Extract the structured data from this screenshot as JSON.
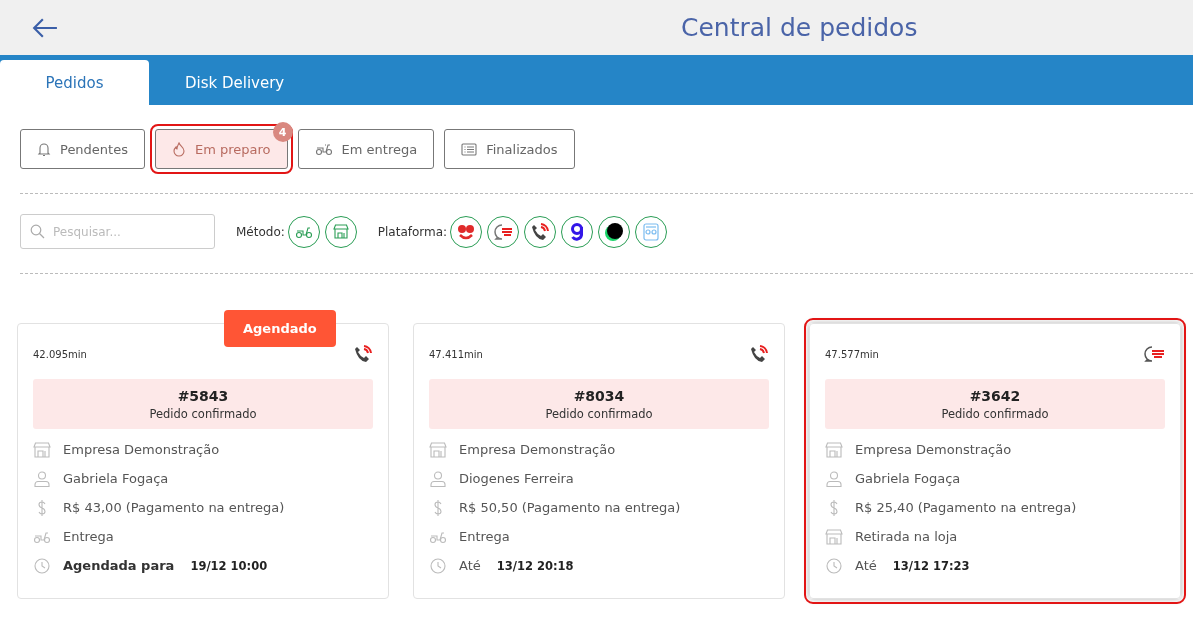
{
  "header": {
    "title": "Central de pedidos"
  },
  "tabs": [
    {
      "label": "Pedidos",
      "selected": true
    },
    {
      "label": "Disk Delivery",
      "selected": false
    }
  ],
  "status_filters": [
    {
      "kind": "bell",
      "label": "Pendentes",
      "selected": false
    },
    {
      "kind": "flame",
      "label": "Em preparo",
      "selected": true,
      "badge": "4"
    },
    {
      "kind": "scooter",
      "label": "Em entrega",
      "selected": false
    },
    {
      "kind": "list",
      "label": "Finalizados",
      "selected": false
    }
  ],
  "search": {
    "placeholder": "Pesquisar..."
  },
  "method_filter": {
    "label": "Método:",
    "options": [
      {
        "kind": "scooter"
      },
      {
        "kind": "store"
      }
    ]
  },
  "platform_filter": {
    "label": "Plataforma:",
    "options": [
      {
        "kind": "smile"
      },
      {
        "kind": "chat"
      },
      {
        "kind": "phone"
      },
      {
        "kind": "loop"
      },
      {
        "kind": "blob"
      },
      {
        "kind": "bot"
      }
    ]
  },
  "orders": [
    {
      "elapsed": "42.095min",
      "platform": {
        "kind": "phone"
      },
      "selected": false,
      "tag": "Agendado",
      "number": "#5843",
      "status": "Pedido confirmado",
      "company": "Empresa Demonstração",
      "customer": "Gabriela Fogaça",
      "payment": "R$ 43,00 (Pagamento na entrega)",
      "method": {
        "kind": "scooter",
        "label": "Entrega"
      },
      "deadline": {
        "label": "Agendada para",
        "bold": true,
        "value": "19/12 10:00"
      }
    },
    {
      "elapsed": "47.411min",
      "platform": {
        "kind": "phone"
      },
      "selected": false,
      "number": "#8034",
      "status": "Pedido confirmado",
      "company": "Empresa Demonstração",
      "customer": "Diogenes Ferreira",
      "payment": "R$ 50,50 (Pagamento na entrega)",
      "method": {
        "kind": "scooter",
        "label": "Entrega"
      },
      "deadline": {
        "label": "Até",
        "bold": false,
        "value": "13/12 20:18"
      }
    },
    {
      "elapsed": "47.577min",
      "platform": {
        "kind": "chat"
      },
      "selected": true,
      "number": "#3642",
      "status": "Pedido confirmado",
      "company": "Empresa Demonstração",
      "customer": "Gabriela Fogaça",
      "payment": "R$ 25,40 (Pagamento na entrega)",
      "method": {
        "kind": "store",
        "label": "Retirada na loja"
      },
      "deadline": {
        "label": "Até",
        "bold": false,
        "value": "13/12 17:23"
      }
    }
  ]
}
